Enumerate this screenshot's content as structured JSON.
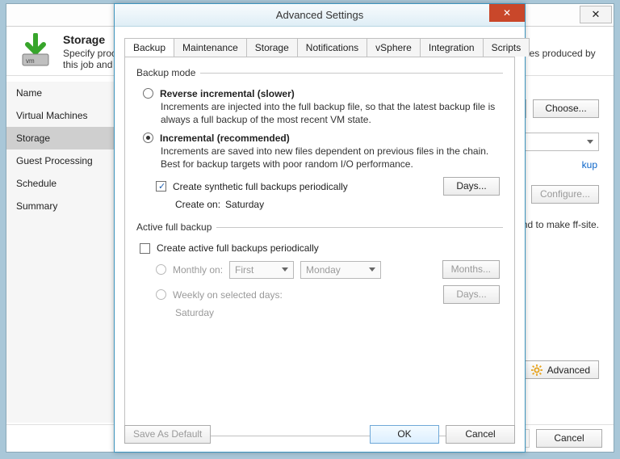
{
  "parent": {
    "title_h": "Storage",
    "title_sub": "Specify processing proxy server to be used for source data retrieval, backup repository to store the backup files produced by this job and customize advanced job settings if required.",
    "side_items": [
      "Name",
      "Virtual Machines",
      "Storage",
      "Guest Processing",
      "Schedule",
      "Summary"
    ],
    "active_side_index": 2,
    "choose_btn": "Choose...",
    "kup_link": "kup",
    "configure_btn": "Configure...",
    "recommend_text": "ecommend to make ff-site.",
    "advanced_btn": "Advanced",
    "footer_cancel": "Cancel"
  },
  "dialog": {
    "title": "Advanced Settings",
    "tabs": [
      "Backup",
      "Maintenance",
      "Storage",
      "Notifications",
      "vSphere",
      "Integration",
      "Scripts"
    ],
    "active_tab_index": 0,
    "backup_mode_legend": "Backup mode",
    "modes": [
      {
        "label": "Reverse incremental (slower)",
        "desc": "Increments are injected into the full backup file, so that the latest backup file is always a full backup of the most recent VM state.",
        "checked": false
      },
      {
        "label": "Incremental (recommended)",
        "desc": "Increments are saved into new files dependent on previous files in the chain. Best for backup targets with poor random I/O performance.",
        "checked": true
      }
    ],
    "synthetic_chk": "Create synthetic full backups periodically",
    "synthetic_checked": true,
    "days_btn": "Days...",
    "create_on_label": "Create on:",
    "create_on_val": "Saturday",
    "active_full_legend": "Active full backup",
    "active_full_chk": "Create active full backups periodically",
    "active_full_checked": false,
    "monthly_label": "Monthly on:",
    "monthly_sel1": "First",
    "monthly_sel2": "Monday",
    "months_btn": "Months...",
    "weekly_label": "Weekly on selected days:",
    "weekly_days_btn": "Days...",
    "weekly_val": "Saturday",
    "save_default_btn": "Save As Default",
    "ok_btn": "OK",
    "cancel_btn": "Cancel"
  }
}
